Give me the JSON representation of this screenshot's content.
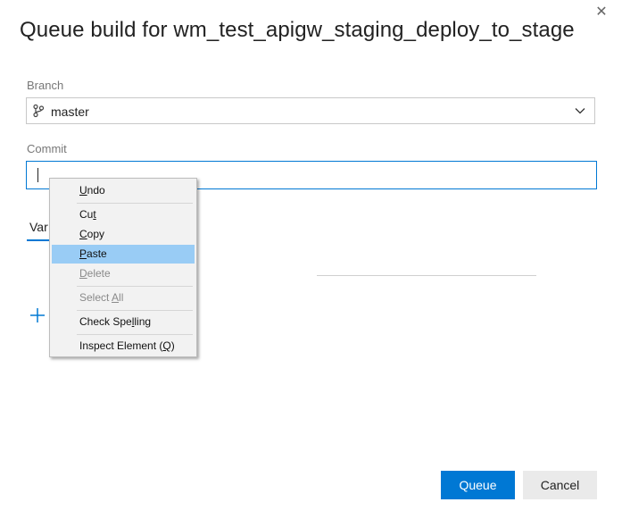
{
  "dialog": {
    "title": "Queue build for wm_test_apigw_staging_deploy_to_stage",
    "close_icon": "close-icon"
  },
  "branch": {
    "label": "Branch",
    "value": "master",
    "icon": "branch-icon"
  },
  "commit": {
    "label": "Commit",
    "value": ""
  },
  "tabs": [
    {
      "label": "Var"
    }
  ],
  "context_menu": {
    "items": [
      {
        "mnemonic": "U",
        "rest": "ndo",
        "prefix": "",
        "disabled": false
      },
      {
        "prefix": "Cu",
        "mnemonic": "t",
        "rest": "",
        "disabled": false
      },
      {
        "prefix": "",
        "mnemonic": "C",
        "rest": "opy",
        "disabled": false
      },
      {
        "prefix": "",
        "mnemonic": "P",
        "rest": "aste",
        "disabled": false,
        "highlighted": true
      },
      {
        "prefix": "",
        "mnemonic": "D",
        "rest": "elete",
        "disabled": true
      },
      {
        "prefix": "Select ",
        "mnemonic": "A",
        "rest": "ll",
        "disabled": true
      },
      {
        "prefix": "Check Spe",
        "mnemonic": "l",
        "rest": "ling",
        "disabled": false
      },
      {
        "prefix": "Inspect Element (",
        "mnemonic": "Q",
        "rest": ")",
        "disabled": false
      }
    ]
  },
  "buttons": {
    "queue": "Queue",
    "cancel": "Cancel"
  },
  "colors": {
    "accent": "#0078d4",
    "menu_highlight": "#99ccf5"
  }
}
